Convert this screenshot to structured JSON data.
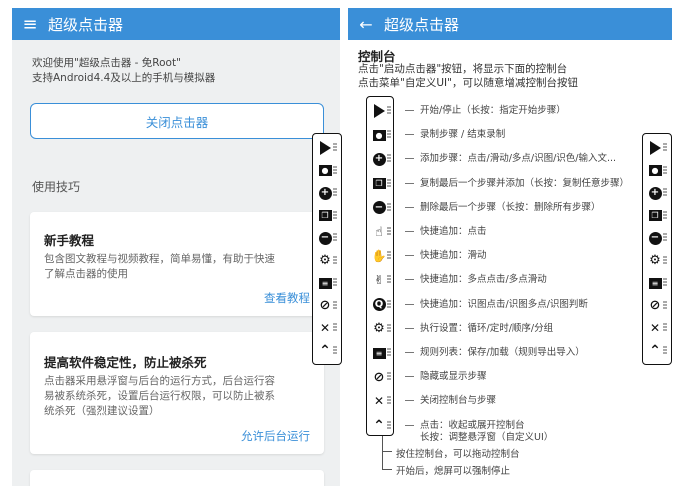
{
  "left": {
    "app_title": "超级点击器",
    "menu_icon": "menu-icon",
    "intro_line1": "欢迎使用\"超级点击器 - 免Root\"",
    "intro_line2": "支持Android4.4及以上的手机与模拟器",
    "close_button": "关闭点击器",
    "tips_title": "使用技巧",
    "cards": [
      {
        "heading": "新手教程",
        "desc_line1": "包含图文教程与视频教程，简单易懂，有助于快速",
        "desc_line2": "了解点击器的使用",
        "link": "查看教程"
      },
      {
        "heading": "提高软件稳定性，防止被杀死",
        "desc_line1": "点击器采用悬浮窗与后台的运行方式，后台运行容",
        "desc_line2": "易被系统杀死，设置后台运行权限，可以防止被系",
        "desc_line3": "统杀死（强烈建议设置）",
        "link": "允许后台运行"
      }
    ]
  },
  "right": {
    "app_title": "超级点击器",
    "back_icon": "back-arrow-icon",
    "panel_title": "控制台",
    "desc_line1": "点击\"启动点击器\"按钮，将显示下面的控制台",
    "desc_line2": "点击菜单\"自定义UI\"，可以随意增减控制台按钮",
    "legend": [
      {
        "icon": "play-icon",
        "text": "开始/停止（长按：指定开始步骤）"
      },
      {
        "icon": "record-icon",
        "text": "录制步骤 / 结束录制"
      },
      {
        "icon": "plus-icon",
        "text": "添加步骤：点击/滑动/多点/识图/识色/输入文..."
      },
      {
        "icon": "copy-icon",
        "text": "复制最后一个步骤并添加（长按：复制任意步骤）"
      },
      {
        "icon": "minus-icon",
        "text": "删除最后一个步骤（长按：删除所有步骤）"
      },
      {
        "icon": "tap-icon",
        "text": "快捷追加：点击"
      },
      {
        "icon": "swipe-icon",
        "text": "快捷追加：滑动"
      },
      {
        "icon": "multi-tap-icon",
        "text": "快捷追加：多点点击/多点滑动"
      },
      {
        "icon": "image-search-icon",
        "text": "快捷追加：识图点击/识图多点/识图判断"
      },
      {
        "icon": "gear-icon",
        "text": "执行设置：循环/定时/顺序/分组"
      },
      {
        "icon": "rules-list-icon",
        "text": "规则列表：保存/加载（规则导出导入）"
      },
      {
        "icon": "eye-off-icon",
        "text": "隐藏或显示步骤"
      },
      {
        "icon": "close-icon",
        "text": "关闭控制台与步骤"
      },
      {
        "icon": "collapse-icon",
        "text": "点击：收起或展开控制台",
        "text2": "长按：调整悬浮窗（自定义UI）"
      }
    ],
    "footnote1": "按住控制台，可以拖动控制台",
    "footnote2": "开始后，熄屏可以强制停止"
  },
  "toolbar_glyphs": [
    "▶",
    "▬",
    "+",
    "❐",
    "−",
    "⚙",
    "❏",
    "⊘",
    "✕",
    "⌃"
  ]
}
